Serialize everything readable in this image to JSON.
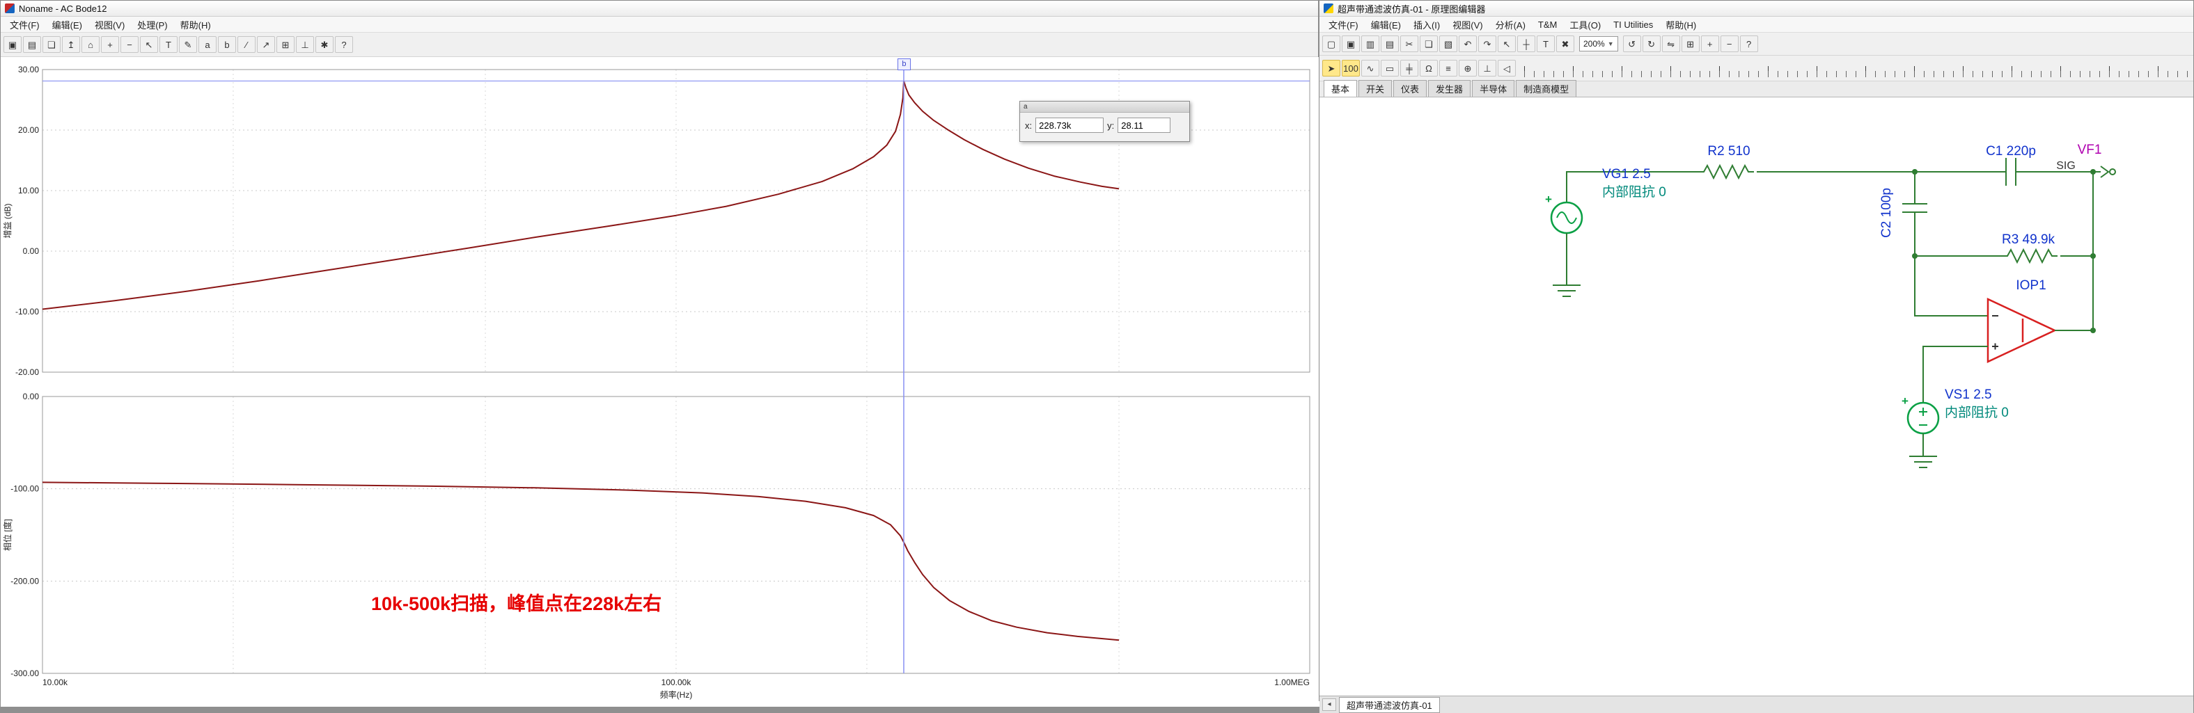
{
  "bode_window": {
    "title": "Noname - AC Bode12",
    "menu": [
      "文件(F)",
      "编辑(E)",
      "视图(V)",
      "处理(P)",
      "帮助(H)"
    ],
    "toolbar": [
      {
        "name": "save-icon",
        "glyph": "▣"
      },
      {
        "name": "print-icon",
        "glyph": "▤"
      },
      {
        "name": "copy-icon",
        "glyph": "❏"
      },
      {
        "name": "export-icon",
        "glyph": "↥"
      },
      {
        "name": "zoom-fit-icon",
        "glyph": "⌂"
      },
      {
        "name": "zoom-in-icon",
        "glyph": "+"
      },
      {
        "name": "zoom-out-icon",
        "glyph": "−"
      },
      {
        "name": "pointer-icon",
        "glyph": "↖"
      },
      {
        "name": "text-icon",
        "glyph": "T"
      },
      {
        "name": "pen-icon",
        "glyph": "✎"
      },
      {
        "name": "cursor-a-icon",
        "glyph": "a"
      },
      {
        "name": "cursor-b-icon",
        "glyph": "b"
      },
      {
        "name": "line-icon",
        "glyph": "∕"
      },
      {
        "name": "arrow-icon",
        "glyph": "↗"
      },
      {
        "name": "grid-icon",
        "glyph": "⊞"
      },
      {
        "name": "axes-icon",
        "glyph": "⊥"
      },
      {
        "name": "settings-icon",
        "glyph": "✱"
      },
      {
        "name": "help-icon",
        "glyph": "?"
      }
    ],
    "cursor_panel": {
      "title": "a",
      "x_label": "x:",
      "x_value": "228.73k",
      "y_label": "y:",
      "y_value": "28.11"
    },
    "marker_label": "b",
    "annotation": "10k-500k扫描，峰值点在228k左右"
  },
  "cursor": {
    "freq": 228730,
    "gain_db": 28.11
  },
  "chart_data": [
    {
      "type": "line",
      "x_scale": "log",
      "x_range": [
        10000,
        1000000
      ],
      "ylim": [
        -20,
        30
      ],
      "yticks": [
        30,
        20,
        10,
        0,
        -10,
        -20
      ],
      "xticks": [
        {
          "v": 10000,
          "label": "10.00k"
        },
        {
          "v": 100000,
          "label": "100.00k"
        },
        {
          "v": 1000000,
          "label": "1.00MEG"
        }
      ],
      "xlabel": "频率(Hz)",
      "ylabel": "增益 (dB)",
      "grid": true,
      "series": [
        {
          "name": "gain",
          "color": "#8b1616",
          "points": [
            [
              10000,
              -9.6
            ],
            [
              13000,
              -8.2
            ],
            [
              17000,
              -6.6
            ],
            [
              22000,
              -4.9
            ],
            [
              28000,
              -3.2
            ],
            [
              36000,
              -1.4
            ],
            [
              47000,
              0.5
            ],
            [
              60000,
              2.3
            ],
            [
              78000,
              4.1
            ],
            [
              100000,
              5.9
            ],
            [
              120000,
              7.4
            ],
            [
              145000,
              9.4
            ],
            [
              170000,
              11.5
            ],
            [
              190000,
              13.6
            ],
            [
              205000,
              15.6
            ],
            [
              215000,
              17.5
            ],
            [
              222000,
              19.8
            ],
            [
              226000,
              22.6
            ],
            [
              228000,
              25.3
            ],
            [
              228730,
              28.11
            ],
            [
              230500,
              27.0
            ],
            [
              233000,
              25.8
            ],
            [
              238000,
              24.5
            ],
            [
              245000,
              23.1
            ],
            [
              255000,
              21.6
            ],
            [
              268000,
              20.1
            ],
            [
              285000,
              18.4
            ],
            [
              305000,
              16.8
            ],
            [
              330000,
              15.2
            ],
            [
              360000,
              13.7
            ],
            [
              395000,
              12.4
            ],
            [
              435000,
              11.4
            ],
            [
              470000,
              10.7
            ],
            [
              500000,
              10.3
            ]
          ]
        }
      ]
    },
    {
      "type": "line",
      "x_scale": "log",
      "x_range": [
        10000,
        1000000
      ],
      "ylim": [
        -300,
        0
      ],
      "yticks": [
        0,
        -100,
        -200,
        -300
      ],
      "xlabel": "频率(Hz)",
      "ylabel": "相位 [度]",
      "grid": true,
      "series": [
        {
          "name": "phase",
          "color": "#8b1616",
          "points": [
            [
              10000,
              -93
            ],
            [
              15000,
              -94
            ],
            [
              25000,
              -95.5
            ],
            [
              40000,
              -97
            ],
            [
              60000,
              -99
            ],
            [
              85000,
              -101.5
            ],
            [
              110000,
              -104.5
            ],
            [
              135000,
              -108.5
            ],
            [
              160000,
              -113.5
            ],
            [
              185000,
              -120.5
            ],
            [
              205000,
              -129
            ],
            [
              218000,
              -139
            ],
            [
              226000,
              -151
            ],
            [
              228730,
              -158
            ],
            [
              232000,
              -167
            ],
            [
              238000,
              -180
            ],
            [
              245000,
              -193
            ],
            [
              255000,
              -207
            ],
            [
              270000,
              -221
            ],
            [
              290000,
              -233
            ],
            [
              315000,
              -243
            ],
            [
              345000,
              -250
            ],
            [
              385000,
              -256
            ],
            [
              430000,
              -260
            ],
            [
              500000,
              -264
            ]
          ]
        }
      ]
    }
  ],
  "schematic_window": {
    "title": "超声带通滤波仿真-01 - 原理图编辑器",
    "menu": [
      "文件(F)",
      "编辑(E)",
      "插入(I)",
      "视图(V)",
      "分析(A)",
      "T&M",
      "工具(O)",
      "TI Utilities",
      "帮助(H)"
    ],
    "toolbar_main_a": [
      {
        "name": "new-icon",
        "glyph": "▢"
      },
      {
        "name": "open-icon",
        "glyph": "▣"
      },
      {
        "name": "save-icon",
        "glyph": "▥"
      },
      {
        "name": "print-icon",
        "glyph": "▤"
      },
      {
        "name": "cut-icon",
        "glyph": "✂"
      },
      {
        "name": "copy-icon",
        "glyph": "❏"
      },
      {
        "name": "paste-icon",
        "glyph": "▧"
      },
      {
        "name": "undo-icon",
        "glyph": "↶"
      },
      {
        "name": "redo-icon",
        "glyph": "↷"
      },
      {
        "name": "pointer-icon",
        "glyph": "↖"
      },
      {
        "name": "wire-icon",
        "glyph": "┼"
      },
      {
        "name": "text-icon",
        "glyph": "T"
      },
      {
        "name": "delete-icon",
        "glyph": "✖"
      }
    ],
    "zoom": "200%",
    "toolbar_main_b": [
      {
        "name": "rotate-left-icon",
        "glyph": "↺"
      },
      {
        "name": "rotate-right-icon",
        "glyph": "↻"
      },
      {
        "name": "flip-icon",
        "glyph": "⇋"
      },
      {
        "name": "grid-icon",
        "glyph": "⊞"
      },
      {
        "name": "zoom-in-icon",
        "glyph": "+"
      },
      {
        "name": "zoom-out-icon",
        "glyph": "−"
      },
      {
        "name": "help-icon",
        "glyph": "?"
      }
    ],
    "toolbar_components": [
      {
        "name": "run-icon",
        "glyph": "➤",
        "accent": true
      },
      {
        "name": "meter-icon",
        "glyph": "100",
        "accent": true
      },
      {
        "name": "generator-icon",
        "glyph": "∿"
      },
      {
        "name": "resistor-icon",
        "glyph": "▭"
      },
      {
        "name": "capacitor-icon",
        "glyph": "╪"
      },
      {
        "name": "ohm-icon",
        "glyph": "Ω"
      },
      {
        "name": "battery-icon",
        "glyph": "≡"
      },
      {
        "name": "node-icon",
        "glyph": "⊕"
      },
      {
        "name": "ground-icon",
        "glyph": "⊥"
      },
      {
        "name": "diode-icon",
        "glyph": "◁"
      }
    ],
    "tabs": [
      {
        "label": "基本",
        "active": true
      },
      {
        "label": "开关",
        "active": false
      },
      {
        "label": "仪表",
        "active": false
      },
      {
        "label": "发生器",
        "active": false
      },
      {
        "label": "半导体",
        "active": false
      },
      {
        "label": "制造商模型",
        "active": false
      }
    ],
    "bottom_tab": "超声带通滤波仿真-01",
    "components": {
      "vg1_label": "VG1 2.5",
      "vg1_impedance": "内部阻抗 0",
      "r2": "R2 510",
      "c1": "C1 220p",
      "c2": "C2 100p",
      "r3": "R3 49.9k",
      "opamp": "IOP1",
      "vs1_label": "VS1 2.5",
      "vs1_impedance": "内部阻抗 0",
      "vf1": "VF1",
      "sig": "SIG"
    }
  }
}
